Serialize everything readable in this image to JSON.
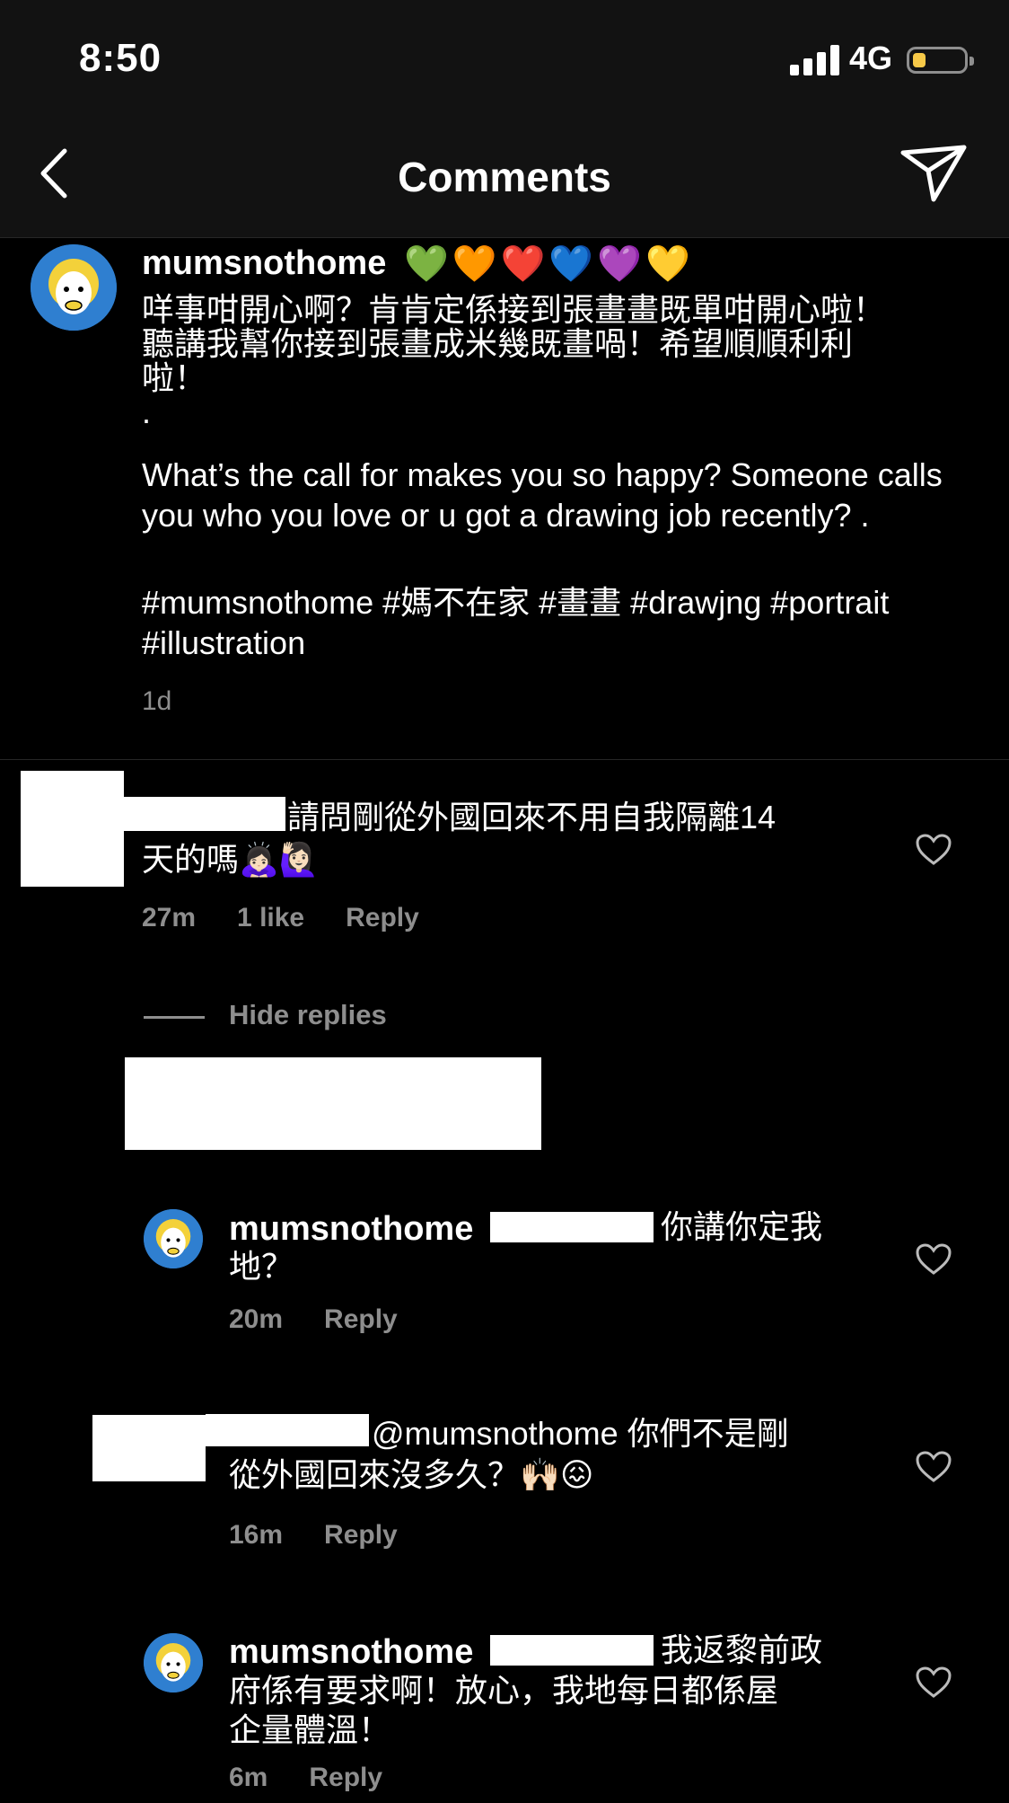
{
  "status": {
    "time": "8:50",
    "network": "4G"
  },
  "header": {
    "title": "Comments"
  },
  "caption": {
    "username": "mumsnothome",
    "emojis": "💚🧡❤️💙💜💛",
    "text_zh": "咩事咁開心啊？肯肯定係接到張畫畫既單咁開心啦！\n聽講我幫你接到張畫成米幾既畫喎！希望順順利利\n啦！\n.",
    "text_en": "What’s the call for makes you so happy? Someone calls you who you love or u got a drawing job recently? .",
    "hashtags": "#mumsnothome #媽不在家 #畫畫 #drawjng #portrait #illustration",
    "time": "1d"
  },
  "comments": [
    {
      "text_line1": "請問剛從外國回來不用自我隔離14",
      "text_line2": "天的嗎🙇🏻‍♀️🙋🏻‍♀️",
      "time": "27m",
      "likes": "1 like",
      "reply_label": "Reply"
    }
  ],
  "hide_replies_label": "Hide replies",
  "replies": [
    {
      "username": "mumsnothome",
      "text_a": "你講你定我",
      "text_b": "地？",
      "time": "20m",
      "reply_label": "Reply"
    },
    {
      "text_a": "@mumsnothome 你們不是剛",
      "text_b": "從外國回來沒多久？🙌🏻😖",
      "time": "16m",
      "reply_label": "Reply"
    },
    {
      "username": "mumsnothome",
      "text_a": "我返黎前政",
      "text_b": "府係有要求啊！放心，我地每日都係屋",
      "text_c": "企量體溫！",
      "time": "6m",
      "reply_label": "Reply"
    }
  ]
}
